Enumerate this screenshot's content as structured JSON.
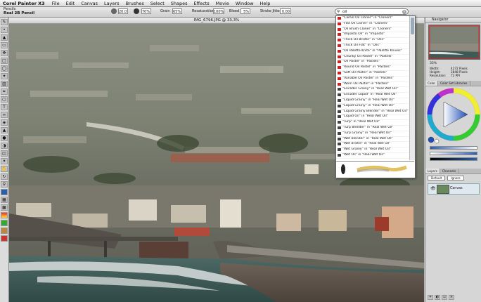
{
  "menubar": {
    "app_name": "Corel Painter X3",
    "items": [
      "File",
      "Edit",
      "Canvas",
      "Layers",
      "Brushes",
      "Select",
      "Shapes",
      "Effects",
      "Movie",
      "Window",
      "Help"
    ]
  },
  "propbar": {
    "brush_category": "Pencils",
    "brush_variant": "Real 2B Pencil",
    "size_value": "20.0",
    "opacity_value": "70%",
    "grain_label": "Grain",
    "grain_value": "65%",
    "resaturation_label": "Resaturation",
    "resaturation_value": "100%",
    "bleed_label": "Bleed",
    "bleed_value": "5%",
    "stroke_jitter_label": "Stroke Jitter",
    "stroke_jitter_value": "0.00"
  },
  "document": {
    "title": "IMG_6796.JPG @ 33.3%"
  },
  "search": {
    "value": "oil"
  },
  "results": [
    "\"Camel Oil Cloner\" in \"Cloners\"",
    "\"Flat Oil Cloner\" in \"Cloners\"",
    "\"Oil Brush Cloner\" in \"Cloners\"",
    "\"Impasto Oil\" in \"Impasto\"",
    "\"Thick Oil Bristle\" in \"Oils\"",
    "\"Thick Oil Flat\" in \"Oils\"",
    "\"Oil Palette Knife\" in \"Palette Knives\"",
    "\"Chunky Oil Pastel\" in \"Pastels\"",
    "\"Oil Pastel\" in \"Pastels\"",
    "\"Round Oil Pastel\" in \"Pastels\"",
    "\"Soft Oil Pastel\" in \"Pastels\"",
    "\"Variable Oil Pastel\" in \"Pastels\"",
    "\"Worn Oil Pastel\" in \"Pastels\"",
    "\"Encoder Grainy\" in \"Real Wet Oil\"",
    "\"Encoder Liquid\" in \"Real Wet Oil\"",
    "\"Liquid Grainy\" in \"Real Wet Oil\"",
    "\"Liquid Grainy\" in \"Real Wet Oil\"",
    "\"Liquid Grainy Blender\" in \"Real Wet Oil\"",
    "\"Liquid Oil\" in \"Real Wet Oil\"",
    "\"Turp\" in \"Real Wet Oil\"",
    "\"Turp Blender\" in \"Real Wet Oil\"",
    "\"Turp Grainy\" in \"Real Wet Oil\"",
    "\"Wet Blender\" in \"Real Wet Oil\"",
    "\"Wet Bristle\" in \"Real Wet Oil\"",
    "\"Wet Grainy\" in \"Real Wet Oil\"",
    "\"Wet Oil\" in \"Real Wet Oil\""
  ],
  "navigator": {
    "title": "Navigator",
    "zoom": "33%",
    "width_label": "Width:",
    "width_value": "4272 Pixels",
    "height_label": "Height:",
    "height_value": "2848 Pixels",
    "resolution_label": "Resolution:",
    "resolution_value": "72 PPI"
  },
  "color_panel": {
    "tabs": [
      "Color",
      "Color Set Libraries"
    ]
  },
  "layers_panel": {
    "tabs": [
      "Layers",
      "Channels"
    ],
    "blend": "Default",
    "composite": "Ignore",
    "layer_name": "Canvas"
  },
  "colors": {
    "menubar": "#e8e8e8",
    "panel": "#d6d6d6",
    "accent": "#2a5fb0",
    "result_icon": "#c22222"
  }
}
